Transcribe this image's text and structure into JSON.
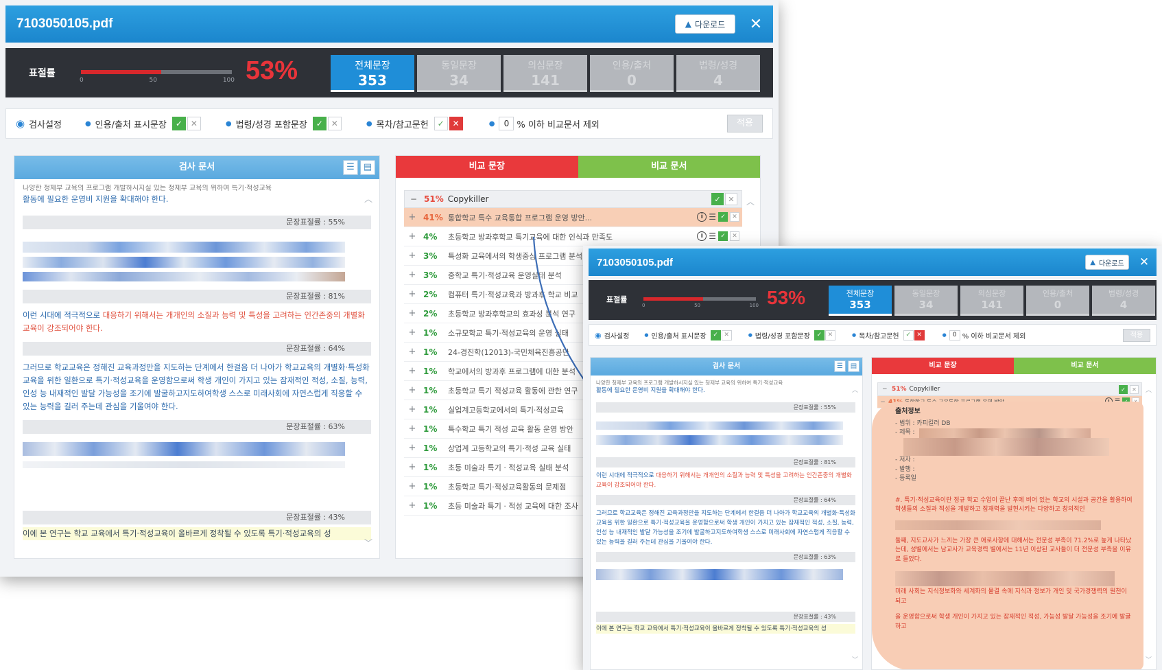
{
  "filename": "7103050105.pdf",
  "download_label": "다운로드",
  "close_glyph": "✕",
  "score": {
    "label": "표절률",
    "percent_text": "53%",
    "value": 0.53,
    "ticks": [
      "0",
      "50",
      "100"
    ]
  },
  "tabs": [
    {
      "label": "전체문장",
      "count": "353",
      "active": true
    },
    {
      "label": "동일문장",
      "count": "34",
      "active": false
    },
    {
      "label": "의심문장",
      "count": "141",
      "active": false
    },
    {
      "label": "인용/출처",
      "count": "0",
      "active": false
    },
    {
      "label": "법령/성경",
      "count": "4",
      "active": false
    }
  ],
  "settings": {
    "title": "검사설정",
    "items": [
      "인용/출처 표시문장",
      "법령/성경 포함문장",
      "목차/참고문헌"
    ],
    "threshold_value": "0",
    "threshold_suffix": "% 이하 비교문서 제외",
    "apply_label": "적용"
  },
  "left_panel": {
    "title": "검사 문서",
    "top_para": "활동에 필요한 운영비 지원을 확대해야 한다.",
    "top_para_partial": "나양한 청제부 교육의 프로그램 개발하시지실 있는 청제부 교육의 위하여 특기·적성교육",
    "rates": [
      "문장표절률 : 55%",
      "문장표절률 : 81%",
      "문장표절률 : 64%",
      "문장표절률 : 63%",
      "문장표절률 : 43%"
    ],
    "p2_prefix": "이런 시대에 적극적으로 ",
    "p2_hl": "대응하기 위해서는 개개인의 소질과 능력 및 특성을 고려하는 인간존중의 개별화 교육이 강조되어야 한다.",
    "p3": "그러므로 학교교육은 정해진 교육과정만을 지도하는 단계에서 한걸음 더 나아가 학교교육의 개별화·특성화 교육을 위한 일환으로 특기·적성교육을 운영함으로써 학생 개인이 가지고 있는 잠재적인 적성, 소질, 능력, 인성 능 내재적인 발달 가능성을 조기에 발굴하고지도하여학생 스스로 미래사회에 자연스럽게 직응할 수 있는 능력을 길러 주는데 관심을 기울여야 한다.",
    "p_last": "이에 본 연구는 학교 교육에서 특기·적성교육이 올바르게 정착될 수 있도록 특기·적성교육의 성"
  },
  "right_panel": {
    "tab_left": "비교 문장",
    "tab_right": "비교 문서",
    "group_pct": "51%",
    "group_name": "Copykiller",
    "rows": [
      {
        "pct": "41%",
        "title": "통합학교 특수 교육통합 프로그램 운영 방안...",
        "sel": true
      },
      {
        "pct": "4%",
        "title": "초등학교 방과후학교 특기교육에 대한 인식과 만족도",
        "sel": false
      },
      {
        "pct": "3%",
        "title": "특성화 교육에서의 학생중심 프로그램 분석",
        "sel": false
      },
      {
        "pct": "3%",
        "title": "중학교 특기·적성교육 운영실태 분석",
        "sel": false
      },
      {
        "pct": "2%",
        "title": "컴퓨터 특기·적성교육과 방과후 학교 비교",
        "sel": false
      },
      {
        "pct": "2%",
        "title": "초등학교 방과후학교의 효과성 분석 연구",
        "sel": false
      },
      {
        "pct": "1%",
        "title": "소규모학교 특기·적성교육의 운영 실태",
        "sel": false
      },
      {
        "pct": "1%",
        "title": "24-경진학(12013)-국민체육진흥공단",
        "sel": false
      },
      {
        "pct": "1%",
        "title": "학교에서의 방과후 프로그램에 대한 분석",
        "sel": false
      },
      {
        "pct": "1%",
        "title": "초등학교 특기 적성교육 활동에 관한 연구",
        "sel": false
      },
      {
        "pct": "1%",
        "title": "실업계고등학교에서의 특기·적성교육",
        "sel": false
      },
      {
        "pct": "1%",
        "title": "특수학교 특기 적성 교육 활동 운영 방안",
        "sel": false
      },
      {
        "pct": "1%",
        "title": "상업계 고등학교의 특기·적성 교육 실태",
        "sel": false
      },
      {
        "pct": "1%",
        "title": "초등 미술과 특기 · 적성교육 실태 분석",
        "sel": false
      },
      {
        "pct": "1%",
        "title": "초등학교 특기·적성교육활동의 문제점",
        "sel": false
      },
      {
        "pct": "1%",
        "title": "초등 미술과 특기 · 적성 교육에 대한 조사",
        "sel": false
      }
    ]
  },
  "source_info": {
    "title": "출처정보",
    "fields": [
      "- 범위 : 카피킬러 DB",
      "- 제목 :",
      "- 저자 :",
      "- 발행 :",
      "- 등록일"
    ],
    "red_text_1": "#. 특기·적성교육이란 정규 학교 수업이 끝난 후에 비어 있는 학교의 시설과 공간을 활용하여학생들의 소질과 적성을 계발하고 잠재력을 발현시키는 다양하고 창의적인",
    "red_text_2": "둘째, 지도교사가 느끼는 가장 큰 애로사항에 대해서는 전문성 부족이 71.2%로 높게 나타났는데, 성별에서는 남교사가 교육경력 별에서는 11년 이상된 교사들이 더 전문성 부족을 이유로 들었다.",
    "red_text_3": "미래 사회는 지식정보화와 세계화의 물결 속에 지식과 정보가 개인 및 국가경쟁력의 원천이 되고",
    "red_text_4": "을 운영함으로써 학생 개인이 가지고 있는 잠재적인 적성, 가능성 발달 가능성을 조기에 발굴하고"
  }
}
